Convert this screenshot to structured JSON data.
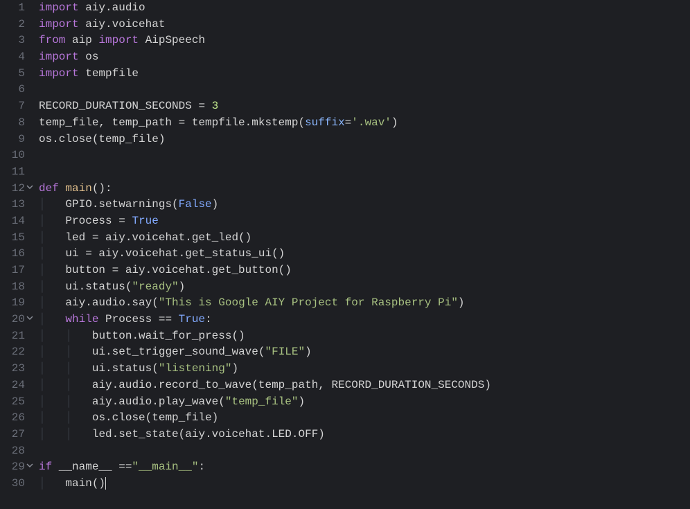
{
  "lines": [
    {
      "n": 1,
      "fold": "",
      "tokens": [
        [
          "kw",
          "import"
        ],
        [
          "mod",
          " aiy.audio"
        ]
      ]
    },
    {
      "n": 2,
      "fold": "",
      "tokens": [
        [
          "kw",
          "import"
        ],
        [
          "mod",
          " aiy.voicehat"
        ]
      ]
    },
    {
      "n": 3,
      "fold": "",
      "tokens": [
        [
          "kw",
          "from"
        ],
        [
          "mod",
          " aip "
        ],
        [
          "kw",
          "import"
        ],
        [
          "mod",
          " AipSpeech"
        ]
      ]
    },
    {
      "n": 4,
      "fold": "",
      "tokens": [
        [
          "kw",
          "import"
        ],
        [
          "mod",
          " os"
        ]
      ]
    },
    {
      "n": 5,
      "fold": "",
      "tokens": [
        [
          "kw",
          "import"
        ],
        [
          "mod",
          " tempfile"
        ]
      ]
    },
    {
      "n": 6,
      "fold": "",
      "tokens": []
    },
    {
      "n": 7,
      "fold": "",
      "tokens": [
        [
          "mod",
          "RECORD_DURATION_SECONDS = "
        ],
        [
          "num",
          "3"
        ]
      ]
    },
    {
      "n": 8,
      "fold": "",
      "tokens": [
        [
          "mod",
          "temp_file, temp_path = tempfile.mkstemp("
        ],
        [
          "kwarg",
          "suffix"
        ],
        [
          "mod",
          "="
        ],
        [
          "str",
          "'.wav'"
        ],
        [
          "mod",
          ")"
        ]
      ]
    },
    {
      "n": 9,
      "fold": "",
      "tokens": [
        [
          "mod",
          "os.close(temp_file)"
        ]
      ]
    },
    {
      "n": 10,
      "fold": "",
      "tokens": []
    },
    {
      "n": 11,
      "fold": "",
      "tokens": []
    },
    {
      "n": 12,
      "fold": "v",
      "tokens": [
        [
          "kw",
          "def "
        ],
        [
          "fn",
          "main"
        ],
        [
          "mod",
          "():"
        ]
      ]
    },
    {
      "n": 13,
      "fold": "",
      "indent": 1,
      "tokens": [
        [
          "mod",
          "    GPIO.setwarnings("
        ],
        [
          "const",
          "False"
        ],
        [
          "mod",
          ")"
        ]
      ]
    },
    {
      "n": 14,
      "fold": "",
      "indent": 1,
      "tokens": [
        [
          "mod",
          "    Process = "
        ],
        [
          "const",
          "True"
        ]
      ]
    },
    {
      "n": 15,
      "fold": "",
      "indent": 1,
      "tokens": [
        [
          "mod",
          "    led = aiy.voicehat.get_led()"
        ]
      ]
    },
    {
      "n": 16,
      "fold": "",
      "indent": 1,
      "tokens": [
        [
          "mod",
          "    ui = aiy.voicehat.get_status_ui()"
        ]
      ]
    },
    {
      "n": 17,
      "fold": "",
      "indent": 1,
      "tokens": [
        [
          "mod",
          "    button = aiy.voicehat.get_button()"
        ]
      ]
    },
    {
      "n": 18,
      "fold": "",
      "indent": 1,
      "tokens": [
        [
          "mod",
          "    ui.status("
        ],
        [
          "str",
          "\"ready\""
        ],
        [
          "mod",
          ")"
        ]
      ]
    },
    {
      "n": 19,
      "fold": "",
      "indent": 1,
      "tokens": [
        [
          "mod",
          "    aiy.audio.say("
        ],
        [
          "str",
          "\"This is Google AIY Project for Raspberry Pi\""
        ],
        [
          "mod",
          ")"
        ]
      ]
    },
    {
      "n": 20,
      "fold": "v",
      "indent": 1,
      "tokens": [
        [
          "mod",
          "    "
        ],
        [
          "kw",
          "while"
        ],
        [
          "mod",
          " Process == "
        ],
        [
          "const",
          "True"
        ],
        [
          "mod",
          ":"
        ]
      ]
    },
    {
      "n": 21,
      "fold": "",
      "indent": 2,
      "tokens": [
        [
          "mod",
          "        button.wait_for_press()"
        ]
      ]
    },
    {
      "n": 22,
      "fold": "",
      "indent": 2,
      "tokens": [
        [
          "mod",
          "        ui.set_trigger_sound_wave("
        ],
        [
          "str",
          "\"FILE\""
        ],
        [
          "mod",
          ")"
        ]
      ]
    },
    {
      "n": 23,
      "fold": "",
      "indent": 2,
      "tokens": [
        [
          "mod",
          "        ui.status("
        ],
        [
          "str",
          "\"listening\""
        ],
        [
          "mod",
          ")"
        ]
      ]
    },
    {
      "n": 24,
      "fold": "",
      "indent": 2,
      "tokens": [
        [
          "mod",
          "        aiy.audio.record_to_wave(temp_path, RECORD_DURATION_SECONDS)"
        ]
      ]
    },
    {
      "n": 25,
      "fold": "",
      "indent": 2,
      "tokens": [
        [
          "mod",
          "        aiy.audio.play_wave("
        ],
        [
          "str",
          "\"temp_file\""
        ],
        [
          "mod",
          ")"
        ]
      ]
    },
    {
      "n": 26,
      "fold": "",
      "indent": 2,
      "tokens": [
        [
          "mod",
          "        os.close(temp_file)"
        ]
      ]
    },
    {
      "n": 27,
      "fold": "",
      "indent": 2,
      "tokens": [
        [
          "mod",
          "        led.set_state(aiy.voicehat.LED.OFF)"
        ]
      ]
    },
    {
      "n": 28,
      "fold": "",
      "tokens": []
    },
    {
      "n": 29,
      "fold": "v",
      "tokens": [
        [
          "kw",
          "if"
        ],
        [
          "mod",
          " __name__ =="
        ],
        [
          "str",
          "\"__main__\""
        ],
        [
          "mod",
          ":"
        ]
      ]
    },
    {
      "n": 30,
      "fold": "",
      "indent": 1,
      "cursor": true,
      "tokens": [
        [
          "mod",
          "    main()"
        ]
      ]
    }
  ]
}
